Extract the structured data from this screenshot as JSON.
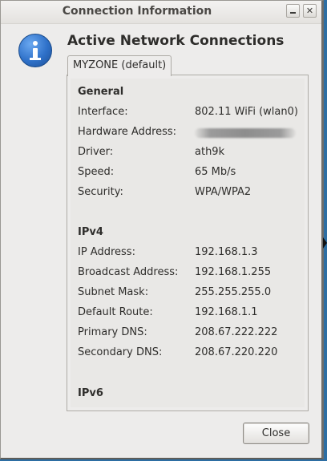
{
  "window": {
    "title": "Connection Information",
    "minimize_icon": "minimize-icon",
    "close_icon": "close-x-icon",
    "close_glyph": "✕"
  },
  "header": {
    "icon": "info-icon",
    "heading": "Active Network Connections"
  },
  "tab": {
    "label": "MYZONE (default)"
  },
  "general": {
    "section_label": "General",
    "rows": [
      {
        "label": "Interface:",
        "value": "802.11 WiFi (wlan0)"
      },
      {
        "label": "Hardware Address:",
        "value": ""
      },
      {
        "label": "Driver:",
        "value": "ath9k"
      },
      {
        "label": "Speed:",
        "value": "65 Mb/s"
      },
      {
        "label": "Security:",
        "value": "WPA/WPA2"
      }
    ]
  },
  "ipv4": {
    "section_label": "IPv4",
    "rows": [
      {
        "label": "IP Address:",
        "value": "192.168.1.3"
      },
      {
        "label": "Broadcast Address:",
        "value": "192.168.1.255"
      },
      {
        "label": "Subnet Mask:",
        "value": "255.255.255.0"
      },
      {
        "label": "Default Route:",
        "value": "192.168.1.1"
      },
      {
        "label": "Primary DNS:",
        "value": "208.67.222.222"
      },
      {
        "label": "Secondary DNS:",
        "value": "208.67.220.220"
      }
    ]
  },
  "ipv6": {
    "section_label": "IPv6"
  },
  "footer": {
    "close_label": "Close"
  }
}
